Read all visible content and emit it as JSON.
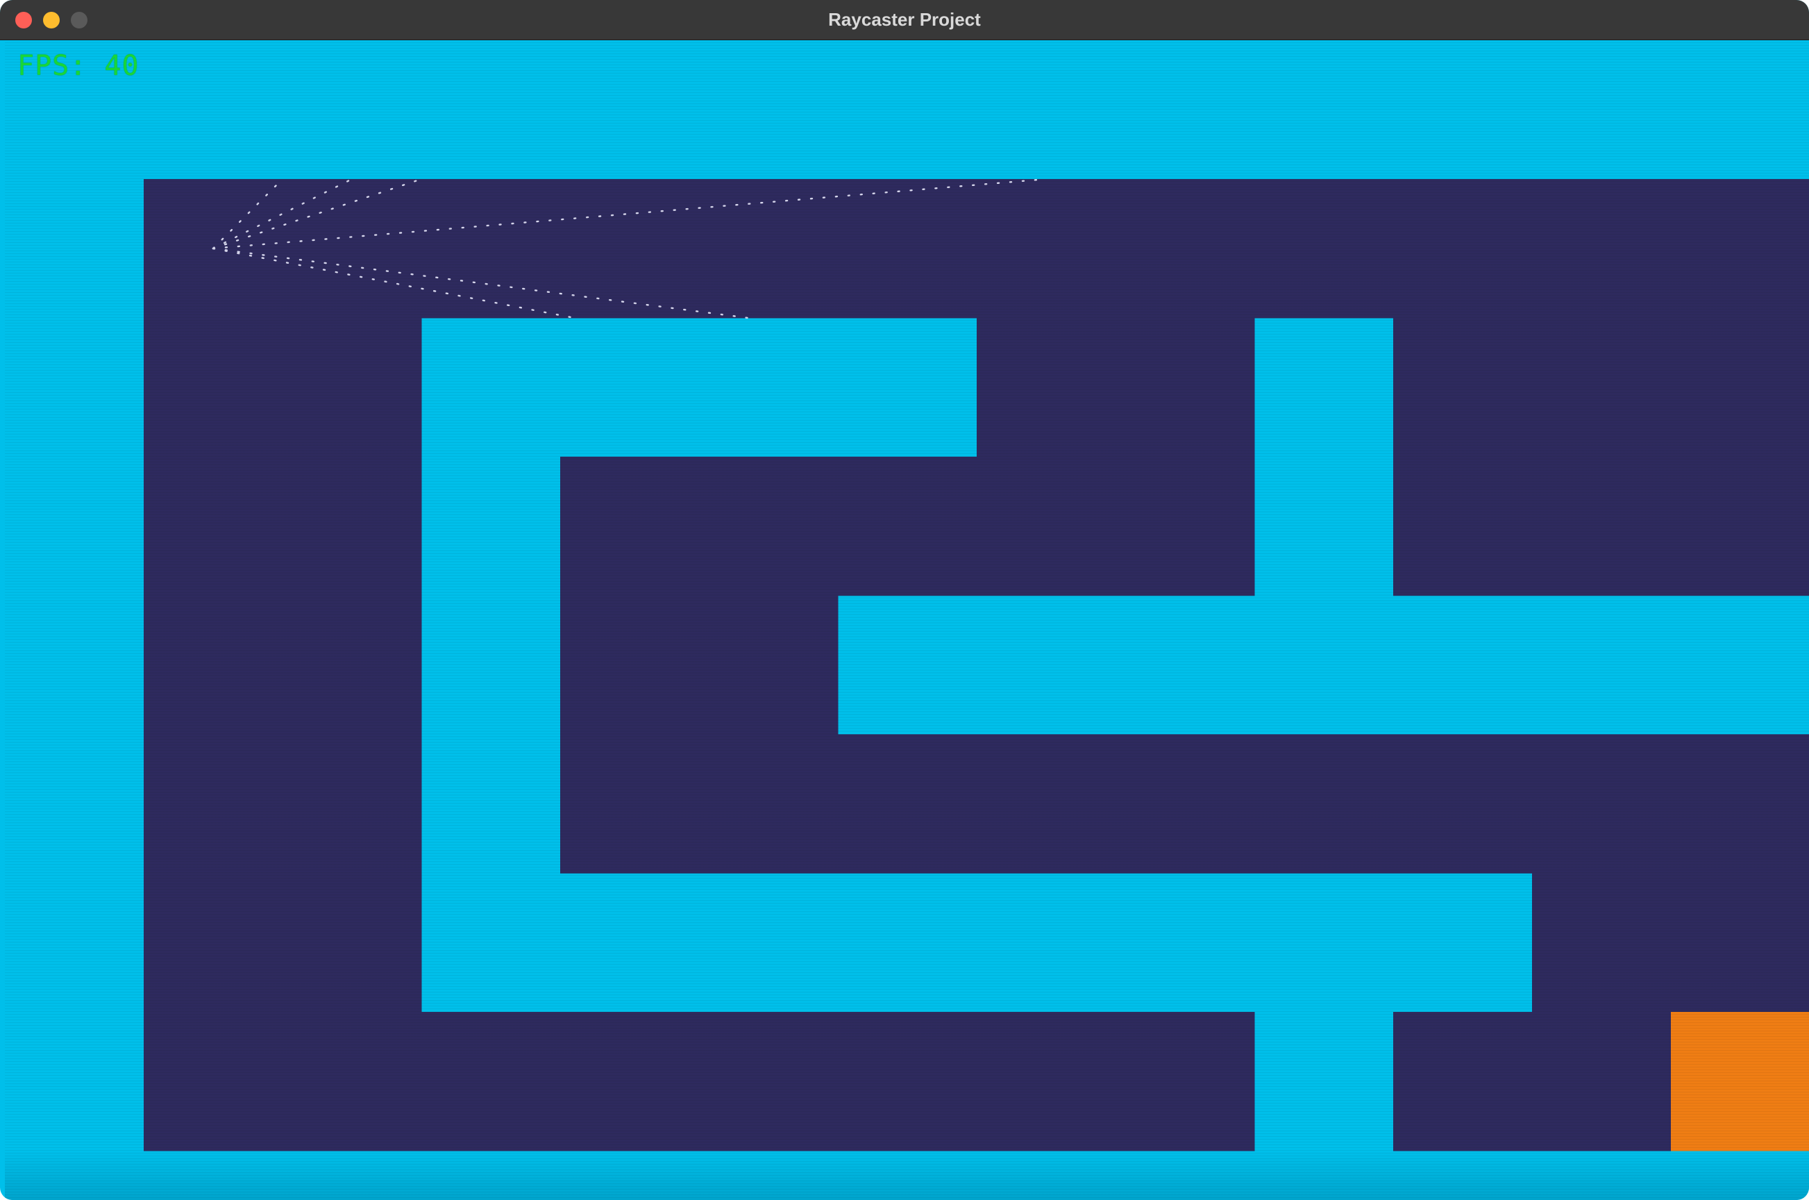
{
  "window": {
    "title": "Raycaster Project"
  },
  "hud": {
    "fps_text": "FPS: 40"
  },
  "colors": {
    "wall": "#00bfea",
    "floor": "#2e2a5e",
    "goal": "#ef7d14",
    "ray": "#d8d8ee",
    "fps": "#18d639",
    "traffic_close": "#fe5f57",
    "traffic_minimize": "#febc2e",
    "traffic_zoom": "#5a5a5a"
  },
  "map": {
    "legend": {
      "1": "wall",
      "0": "floor",
      "2": "goal"
    },
    "grid": [
      "11111111111111",
      "10000000000001",
      "10011110010001",
      "10010000010001",
      "10010011111111",
      "10010000000001",
      "10011111111001",
      "10000000010021",
      "11111111111111"
    ]
  },
  "player": {
    "cell": [
      1,
      1
    ]
  },
  "icons": {
    "close": "close-icon",
    "minimize": "minimize-icon",
    "zoom": "zoom-icon"
  }
}
